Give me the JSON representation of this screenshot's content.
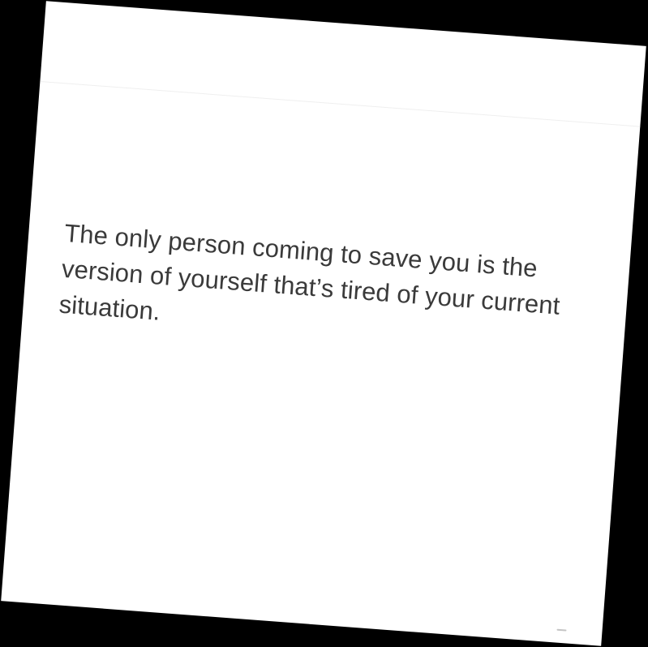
{
  "note": {
    "body_text": "The only person coming to save you is the version of yourself that’s tired of your current situation."
  },
  "colors": {
    "background": "#000000",
    "page": "#ffffff",
    "text": "#3a3a3a",
    "divider": "#efefef"
  }
}
